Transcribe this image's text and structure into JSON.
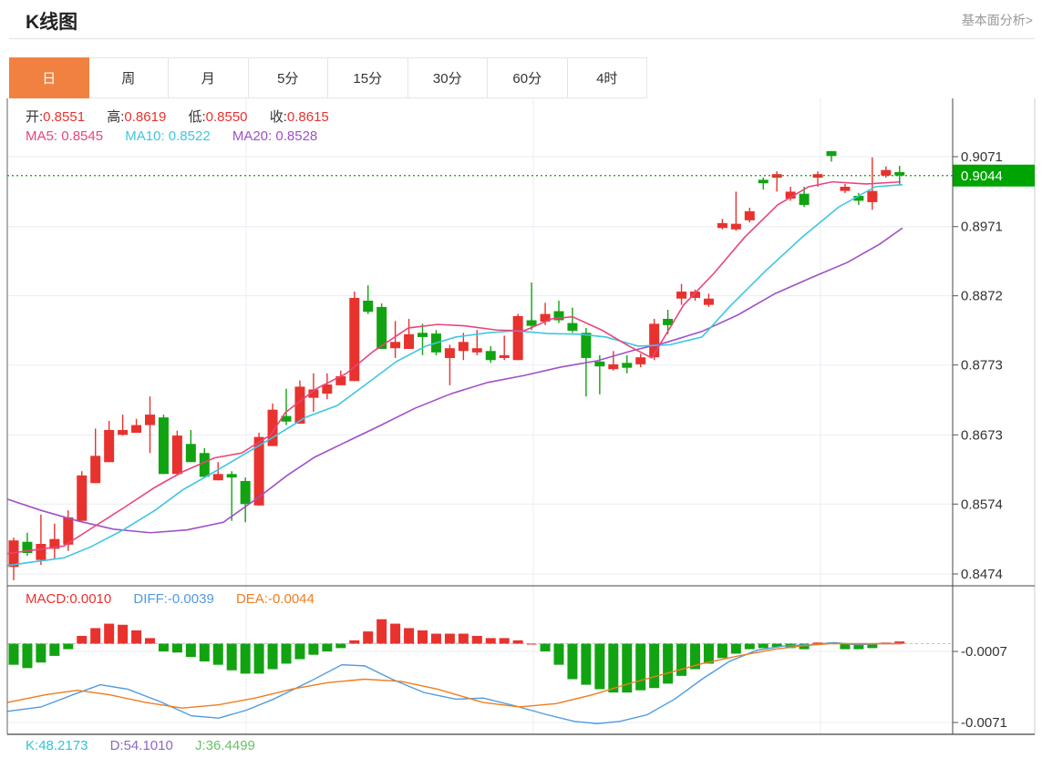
{
  "header": {
    "title": "K线图",
    "link": "基本面分析>"
  },
  "tabs": {
    "active": "日",
    "items": [
      "日",
      "周",
      "月",
      "5分",
      "15分",
      "30分",
      "60分",
      "4时"
    ]
  },
  "legend": {
    "ohlc": [
      {
        "label": "开:",
        "value": "0.8551"
      },
      {
        "label": "高:",
        "value": "0.8619"
      },
      {
        "label": "低:",
        "value": "0.8550"
      },
      {
        "label": "收:",
        "value": "0.8615"
      }
    ],
    "ma": [
      {
        "label": "MA5:",
        "value": "0.8545",
        "color": "#e8457c"
      },
      {
        "label": "MA10:",
        "value": "0.8522",
        "color": "#3fc6e3"
      },
      {
        "label": "MA20:",
        "value": "0.8528",
        "color": "#a050c8"
      }
    ],
    "macd": [
      {
        "label": "MACD:",
        "value": "0.0010",
        "color": "#e8322e"
      },
      {
        "label": "DIFF:",
        "value": "-0.0039",
        "color": "#4f9be0"
      },
      {
        "label": "DEA:",
        "value": "-0.0044",
        "color": "#ef7d1e"
      }
    ],
    "kdj": [
      {
        "label": "K:",
        "value": "48.2173",
        "color": "#35c0d8"
      },
      {
        "label": "D:",
        "value": "54.1010",
        "color": "#8b68c8"
      },
      {
        "label": "J:",
        "value": "36.4499",
        "color": "#67c267"
      }
    ]
  },
  "axis": {
    "main_ticks": [
      {
        "label": "0.9071",
        "price": 0.9071
      },
      {
        "label": "0.8971",
        "price": 0.8971
      },
      {
        "label": "0.8872",
        "price": 0.8872
      },
      {
        "label": "0.8773",
        "price": 0.8773
      },
      {
        "label": "0.8673",
        "price": 0.8673
      },
      {
        "label": "0.8574",
        "price": 0.8574
      },
      {
        "label": "0.8474",
        "price": 0.8474
      }
    ],
    "macd_ticks": [
      {
        "label": "-0.0007",
        "value": -0.0007
      },
      {
        "label": "-0.0071",
        "value": -0.0071
      }
    ],
    "current_price_label": "0.9044"
  },
  "colors": {
    "up": "#e8322e",
    "down": "#12a312",
    "ma5": "#e8457c",
    "ma10": "#3fc6e3",
    "ma20": "#a050c8",
    "diff": "#4f9be0",
    "dea": "#ef7d1e",
    "grid": "#e8edf4",
    "dark_border": "#444444",
    "light_border": "#cccccc",
    "zero_dash": "#a8c8e8",
    "price_line": "#00a400",
    "price_label_bg": "#00a400",
    "axis_text": "#333333",
    "active_tab": "#f08140"
  },
  "chart_data": {
    "type": "candlestick",
    "title": "K线图 (daily K-line with MA5/MA10/MA20, MACD and KDJ)",
    "ylim": [
      0.8457,
      0.9154
    ],
    "macd_ylim": [
      -0.0082,
      0.0052
    ],
    "current_price": 0.9044,
    "candles_ohlc": [
      [
        0.8484,
        0.8526,
        0.8465,
        0.8522
      ],
      [
        0.852,
        0.8533,
        0.85,
        0.8504
      ],
      [
        0.8494,
        0.8559,
        0.8487,
        0.8517
      ],
      [
        0.851,
        0.8546,
        0.8496,
        0.8524
      ],
      [
        0.8516,
        0.8565,
        0.8507,
        0.8555
      ],
      [
        0.855,
        0.8621,
        0.855,
        0.8615
      ],
      [
        0.8604,
        0.8682,
        0.8604,
        0.8643
      ],
      [
        0.8634,
        0.8693,
        0.8634,
        0.868
      ],
      [
        0.8673,
        0.8702,
        0.8672,
        0.868
      ],
      [
        0.8676,
        0.8696,
        0.8676,
        0.8687
      ],
      [
        0.8687,
        0.8728,
        0.8647,
        0.8702
      ],
      [
        0.8698,
        0.8702,
        0.8617,
        0.8617
      ],
      [
        0.8617,
        0.8679,
        0.8617,
        0.8672
      ],
      [
        0.866,
        0.868,
        0.8634,
        0.8634
      ],
      [
        0.8647,
        0.8654,
        0.8613,
        0.8613
      ],
      [
        0.8608,
        0.8634,
        0.8608,
        0.8617
      ],
      [
        0.8617,
        0.8621,
        0.855,
        0.8612
      ],
      [
        0.8607,
        0.8612,
        0.8548,
        0.8574
      ],
      [
        0.8572,
        0.8676,
        0.8572,
        0.867
      ],
      [
        0.8657,
        0.8718,
        0.8657,
        0.8709
      ],
      [
        0.87,
        0.8739,
        0.8687,
        0.8692
      ],
      [
        0.8689,
        0.8751,
        0.8689,
        0.8742
      ],
      [
        0.8726,
        0.8761,
        0.8706,
        0.8738
      ],
      [
        0.8732,
        0.8761,
        0.8724,
        0.8745
      ],
      [
        0.8744,
        0.8765,
        0.8744,
        0.8757
      ],
      [
        0.875,
        0.8878,
        0.875,
        0.8869
      ],
      [
        0.8865,
        0.8887,
        0.8846,
        0.8849
      ],
      [
        0.8856,
        0.8861,
        0.8796,
        0.8796
      ],
      [
        0.8797,
        0.8836,
        0.8783,
        0.8806
      ],
      [
        0.8796,
        0.8839,
        0.8796,
        0.8817
      ],
      [
        0.8819,
        0.8832,
        0.8787,
        0.8813
      ],
      [
        0.8818,
        0.8823,
        0.8787,
        0.8791
      ],
      [
        0.8783,
        0.8802,
        0.8744,
        0.8797
      ],
      [
        0.8793,
        0.8819,
        0.878,
        0.8806
      ],
      [
        0.8791,
        0.8823,
        0.8787,
        0.8797
      ],
      [
        0.8793,
        0.88,
        0.8776,
        0.878
      ],
      [
        0.8783,
        0.8815,
        0.878,
        0.8787
      ],
      [
        0.878,
        0.8846,
        0.878,
        0.8843
      ],
      [
        0.8837,
        0.8891,
        0.8823,
        0.8829
      ],
      [
        0.8835,
        0.8862,
        0.883,
        0.8846
      ],
      [
        0.885,
        0.8865,
        0.8833,
        0.8837
      ],
      [
        0.8833,
        0.8855,
        0.8819,
        0.8822
      ],
      [
        0.8819,
        0.8826,
        0.8728,
        0.8783
      ],
      [
        0.8778,
        0.8787,
        0.8731,
        0.8771
      ],
      [
        0.8767,
        0.8793,
        0.8765,
        0.8774
      ],
      [
        0.8776,
        0.8787,
        0.8761,
        0.8769
      ],
      [
        0.8774,
        0.8789,
        0.877,
        0.8784
      ],
      [
        0.8784,
        0.8839,
        0.878,
        0.8832
      ],
      [
        0.8839,
        0.8852,
        0.8817,
        0.883
      ],
      [
        0.8868,
        0.8889,
        0.8859,
        0.8878
      ],
      [
        0.8869,
        0.8881,
        0.8865,
        0.8878
      ],
      [
        0.8859,
        0.8875,
        0.8856,
        0.8868
      ],
      [
        0.8969,
        0.8982,
        0.8967,
        0.8976
      ],
      [
        0.8967,
        0.9021,
        0.8965,
        0.8975
      ],
      [
        0.898,
        0.8998,
        0.8977,
        0.8993
      ],
      [
        0.9038,
        0.9041,
        0.9024,
        0.9033
      ],
      [
        0.9041,
        0.905,
        0.9021,
        0.9046
      ],
      [
        0.9011,
        0.9028,
        0.9008,
        0.9021
      ],
      [
        0.9018,
        0.9028,
        0.8999,
        0.9002
      ],
      [
        0.9041,
        0.905,
        0.9028,
        0.9046
      ],
      [
        0.9079,
        0.9079,
        0.9064,
        0.9072
      ],
      [
        0.9022,
        0.9032,
        0.9019,
        0.9028
      ],
      [
        0.9015,
        0.9019,
        0.9002,
        0.9008
      ],
      [
        0.9006,
        0.907,
        0.8995,
        0.9022
      ],
      [
        0.9044,
        0.9057,
        0.9041,
        0.9052
      ],
      [
        0.9049,
        0.9058,
        0.9031,
        0.9044
      ]
    ],
    "ma5_points": [
      [
        8,
        0.8503
      ],
      [
        35,
        0.8508
      ],
      [
        70,
        0.8514
      ],
      [
        100,
        0.8539
      ],
      [
        135,
        0.8568
      ],
      [
        170,
        0.8598
      ],
      [
        200,
        0.862
      ],
      [
        235,
        0.864
      ],
      [
        265,
        0.8647
      ],
      [
        297,
        0.8673
      ],
      [
        313,
        0.8705
      ],
      [
        347,
        0.8739
      ],
      [
        380,
        0.8761
      ],
      [
        410,
        0.8793
      ],
      [
        448,
        0.8826
      ],
      [
        480,
        0.8831
      ],
      [
        510,
        0.8829
      ],
      [
        545,
        0.8823
      ],
      [
        575,
        0.8822
      ],
      [
        605,
        0.8839
      ],
      [
        628,
        0.8842
      ],
      [
        660,
        0.8823
      ],
      [
        690,
        0.88
      ],
      [
        715,
        0.8783
      ],
      [
        750,
        0.8859
      ],
      [
        783,
        0.8904
      ],
      [
        817,
        0.8956
      ],
      [
        853,
        0.9002
      ],
      [
        887,
        0.9028
      ],
      [
        913,
        0.9035
      ],
      [
        950,
        0.9032
      ],
      [
        988,
        0.9035
      ]
    ],
    "ma10_points": [
      [
        8,
        0.8486
      ],
      [
        35,
        0.8491
      ],
      [
        70,
        0.8497
      ],
      [
        100,
        0.8513
      ],
      [
        135,
        0.8537
      ],
      [
        170,
        0.8565
      ],
      [
        200,
        0.8594
      ],
      [
        235,
        0.862
      ],
      [
        265,
        0.8643
      ],
      [
        300,
        0.867
      ],
      [
        335,
        0.8698
      ],
      [
        370,
        0.8715
      ],
      [
        400,
        0.8744
      ],
      [
        435,
        0.8778
      ],
      [
        467,
        0.88
      ],
      [
        500,
        0.8813
      ],
      [
        535,
        0.8819
      ],
      [
        565,
        0.8822
      ],
      [
        600,
        0.8818
      ],
      [
        635,
        0.8817
      ],
      [
        665,
        0.8813
      ],
      [
        700,
        0.88
      ],
      [
        735,
        0.8802
      ],
      [
        770,
        0.8813
      ],
      [
        800,
        0.8856
      ],
      [
        840,
        0.8908
      ],
      [
        880,
        0.8956
      ],
      [
        920,
        0.8999
      ],
      [
        960,
        0.9028
      ],
      [
        990,
        0.9031
      ]
    ],
    "ma20_points": [
      [
        8,
        0.8581
      ],
      [
        45,
        0.8565
      ],
      [
        85,
        0.855
      ],
      [
        125,
        0.8538
      ],
      [
        165,
        0.8533
      ],
      [
        205,
        0.8537
      ],
      [
        245,
        0.8548
      ],
      [
        285,
        0.8585
      ],
      [
        315,
        0.8615
      ],
      [
        345,
        0.8641
      ],
      [
        375,
        0.866
      ],
      [
        415,
        0.8685
      ],
      [
        455,
        0.8711
      ],
      [
        495,
        0.8732
      ],
      [
        535,
        0.8748
      ],
      [
        575,
        0.8758
      ],
      [
        615,
        0.877
      ],
      [
        655,
        0.8779
      ],
      [
        695,
        0.8794
      ],
      [
        730,
        0.8805
      ],
      [
        770,
        0.8821
      ],
      [
        810,
        0.8845
      ],
      [
        850,
        0.8875
      ],
      [
        890,
        0.8898
      ],
      [
        930,
        0.892
      ],
      [
        965,
        0.8946
      ],
      [
        990,
        0.8969
      ]
    ],
    "macd_histogram": [
      -0.0019,
      -0.0022,
      -0.0017,
      -0.0011,
      -0.0005,
      0.0007,
      0.0014,
      0.0018,
      0.0017,
      0.0012,
      0.0005,
      -0.0007,
      -0.0008,
      -0.0012,
      -0.0016,
      -0.0019,
      -0.0024,
      -0.0027,
      -0.0027,
      -0.0023,
      -0.0018,
      -0.0014,
      -0.001,
      -0.0007,
      -0.0004,
      0.0003,
      0.0011,
      0.0022,
      0.0018,
      0.0014,
      0.0012,
      0.0009,
      0.0009,
      0.0009,
      0.0007,
      0.0005,
      0.0005,
      0.0003,
      0.0,
      -0.0007,
      -0.0019,
      -0.0032,
      -0.0037,
      -0.0041,
      -0.0044,
      -0.0044,
      -0.0042,
      -0.004,
      -0.0036,
      -0.0029,
      -0.0023,
      -0.0018,
      -0.0013,
      -0.0009,
      -0.0005,
      -0.0004,
      -0.0003,
      -0.0004,
      -0.0005,
      0.0001,
      0.0001,
      -0.0005,
      -0.0005,
      -0.0004,
      0.0001,
      0.0002
    ],
    "diff_points": [
      [
        8,
        -0.0061
      ],
      [
        45,
        -0.0057
      ],
      [
        80,
        -0.0046
      ],
      [
        110,
        -0.0037
      ],
      [
        140,
        -0.0041
      ],
      [
        175,
        -0.0052
      ],
      [
        210,
        -0.0065
      ],
      [
        240,
        -0.0067
      ],
      [
        270,
        -0.006
      ],
      [
        300,
        -0.005
      ],
      [
        340,
        -0.0034
      ],
      [
        375,
        -0.0019
      ],
      [
        400,
        -0.002
      ],
      [
        430,
        -0.0032
      ],
      [
        465,
        -0.0044
      ],
      [
        500,
        -0.005
      ],
      [
        530,
        -0.0049
      ],
      [
        565,
        -0.0056
      ],
      [
        600,
        -0.0064
      ],
      [
        630,
        -0.007
      ],
      [
        655,
        -0.0072
      ],
      [
        680,
        -0.007
      ],
      [
        710,
        -0.0064
      ],
      [
        740,
        -0.005
      ],
      [
        770,
        -0.0032
      ],
      [
        800,
        -0.0016
      ],
      [
        830,
        -0.0006
      ],
      [
        860,
        -0.0002
      ],
      [
        890,
        -0.0001
      ],
      [
        915,
        0.0001
      ],
      [
        940,
        -0.0001
      ],
      [
        965,
        0.0
      ],
      [
        988,
        0.0
      ]
    ],
    "dea_points": [
      [
        8,
        -0.0053
      ],
      [
        50,
        -0.0046
      ],
      [
        85,
        -0.0042
      ],
      [
        120,
        -0.0046
      ],
      [
        160,
        -0.0053
      ],
      [
        200,
        -0.0058
      ],
      [
        240,
        -0.0055
      ],
      [
        280,
        -0.0049
      ],
      [
        320,
        -0.0041
      ],
      [
        360,
        -0.0035
      ],
      [
        400,
        -0.0032
      ],
      [
        440,
        -0.0034
      ],
      [
        480,
        -0.0041
      ],
      [
        530,
        -0.0053
      ],
      [
        570,
        -0.0057
      ],
      [
        610,
        -0.0054
      ],
      [
        650,
        -0.0046
      ],
      [
        690,
        -0.0036
      ],
      [
        730,
        -0.0027
      ],
      [
        770,
        -0.0018
      ],
      [
        810,
        -0.0011
      ],
      [
        850,
        -0.0005
      ],
      [
        880,
        -0.0002
      ],
      [
        910,
        0.0
      ],
      [
        940,
        0.0
      ],
      [
        970,
        0.0
      ],
      [
        990,
        0.0
      ]
    ]
  }
}
